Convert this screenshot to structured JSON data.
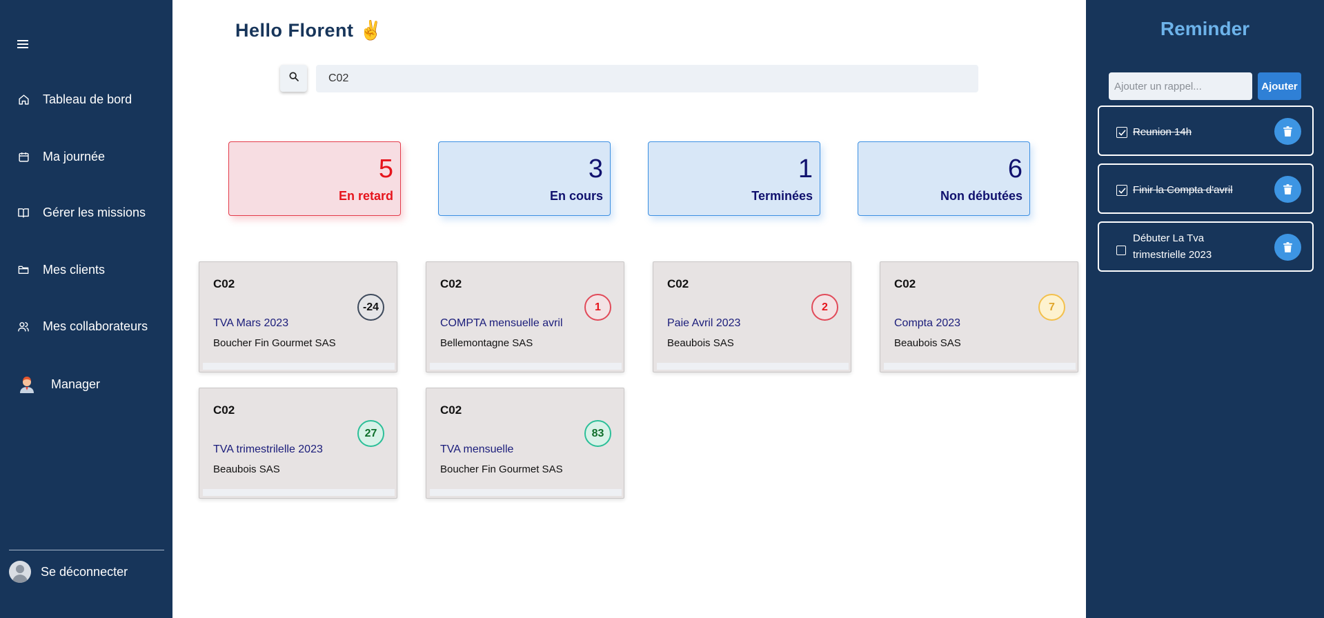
{
  "sidebar": {
    "items": [
      {
        "label": "Tableau de bord",
        "icon": "home-icon"
      },
      {
        "label": "Ma journée",
        "icon": "calendar-icon"
      },
      {
        "label": "Gérer les missions",
        "icon": "book-icon"
      },
      {
        "label": "Mes clients",
        "icon": "folder-icon"
      },
      {
        "label": "Mes collaborateurs",
        "icon": "users-icon"
      },
      {
        "label": "Manager",
        "icon": "manager-avatar-icon"
      }
    ],
    "logout_label": "Se déconnecter"
  },
  "main": {
    "greeting": "Hello Florent ✌️",
    "search": {
      "value": "C02"
    },
    "stats": [
      {
        "value": "5",
        "label": "En retard",
        "color": "#e6141c"
      },
      {
        "value": "3",
        "label": "En cours",
        "color": "#10116e"
      },
      {
        "value": "1",
        "label": "Terminées",
        "color": "#10116e"
      },
      {
        "value": "6",
        "label": "Non débutées",
        "color": "#10116e"
      }
    ],
    "missions": [
      {
        "code": "C02",
        "badge": "-24",
        "title": "TVA Mars 2023",
        "client": "Boucher Fin Gourmet SAS"
      },
      {
        "code": "C02",
        "badge": "1",
        "title": "COMPTA mensuelle avril",
        "client": "Bellemontagne SAS"
      },
      {
        "code": "C02",
        "badge": "2",
        "title": "Paie Avril 2023",
        "client": "Beaubois SAS"
      },
      {
        "code": "C02",
        "badge": "7",
        "title": "Compta 2023",
        "client": "Beaubois SAS"
      },
      {
        "code": "C02",
        "badge": "27",
        "title": "TVA trimestrilelle 2023",
        "client": "Beaubois SAS"
      },
      {
        "code": "C02",
        "badge": "83",
        "title": "TVA mensuelle",
        "client": "Boucher Fin Gourmet SAS"
      }
    ]
  },
  "reminder": {
    "title": "Reminder",
    "input_placeholder": "Ajouter un rappel...",
    "add_label": "Ajouter",
    "items": [
      {
        "text": "Reunion 14h",
        "checked": true
      },
      {
        "text": "Finir la Compta d'avril",
        "checked": true
      },
      {
        "text_line1": "Débuter La Tva",
        "text_line2": "trimestrielle 2023",
        "checked": false
      }
    ]
  },
  "colors": {
    "sidebar_bg": "#17355a",
    "accent_blue": "#2f80d6",
    "reminder_title": "#6db3ea",
    "late_red": "#e6141c",
    "dark_navy": "#10116e"
  }
}
